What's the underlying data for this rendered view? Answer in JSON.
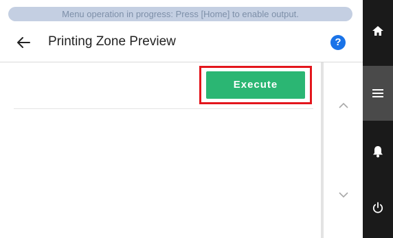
{
  "banner": {
    "message": "Menu operation in progress: Press [Home] to enable output."
  },
  "header": {
    "title": "Printing Zone Preview",
    "help_label": "?"
  },
  "main": {
    "execute_label": "Execute"
  },
  "side_nav": {
    "items": [
      {
        "icon": "home-icon",
        "active": false
      },
      {
        "icon": "menu-icon",
        "active": true
      },
      {
        "icon": "bell-icon",
        "active": false
      },
      {
        "icon": "power-icon",
        "active": false
      }
    ]
  },
  "colors": {
    "banner_bg": "#c4cfe2",
    "banner_text": "#7d8fa8",
    "accent_green": "#2bb673",
    "highlight_red": "#e3151c",
    "help_blue": "#1a73e8",
    "sidebar_bg": "#1a1a1a",
    "sidebar_active": "#4a4a4a"
  }
}
